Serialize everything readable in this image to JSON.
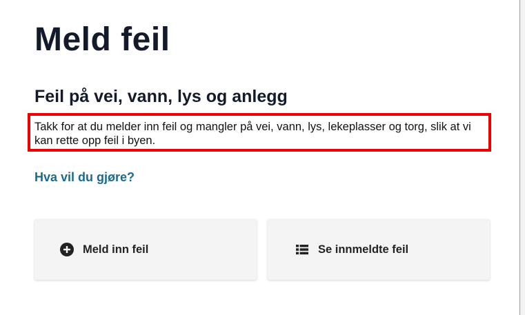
{
  "page": {
    "title": "Meld feil"
  },
  "section": {
    "title": "Feil på vei, vann, lys og anlegg",
    "intro": "Takk for at du melder inn feil og mangler på vei, vann, lys, lekeplasser og torg, slik at vi kan rette opp feil i byen.",
    "question": "Hva vil du gjøre?"
  },
  "actions": [
    {
      "label": "Meld inn feil",
      "icon": "plus-circle-icon"
    },
    {
      "label": "Se innmeldte feil",
      "icon": "list-icon"
    }
  ],
  "colors": {
    "highlight_border": "#ee0000",
    "link": "#1a6a92",
    "title": "#131a2a",
    "card_background": "#f4f4f4"
  }
}
